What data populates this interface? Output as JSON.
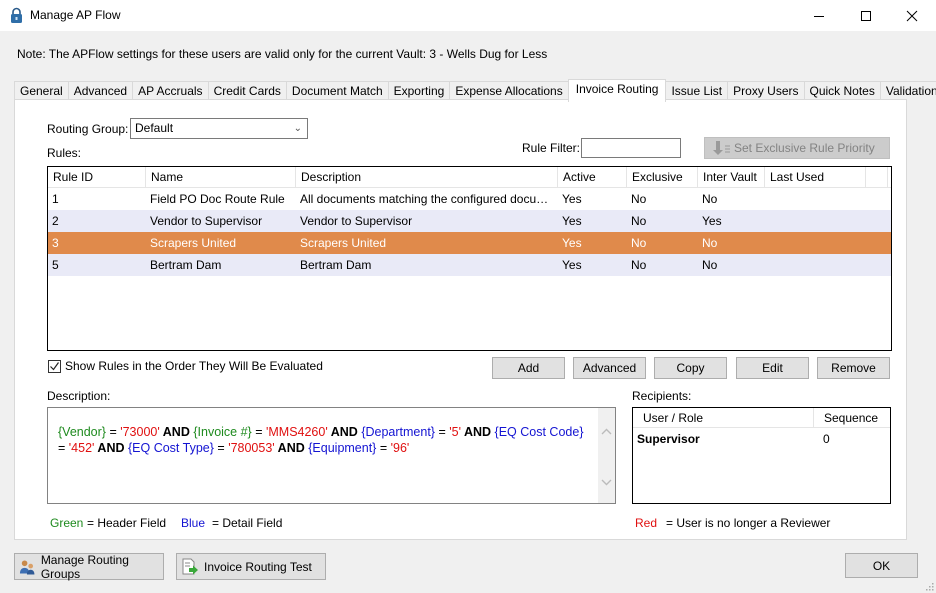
{
  "window": {
    "title": "Manage AP Flow",
    "icon": "padlock-icon",
    "controls": [
      "minimize",
      "maximize",
      "close"
    ]
  },
  "note": "Note:  The APFlow settings for these users are valid only for the current Vault: 3 - Wells Dug for Less",
  "tabs": [
    {
      "label": "General",
      "active": false
    },
    {
      "label": "Advanced",
      "active": false
    },
    {
      "label": "AP Accruals",
      "active": false
    },
    {
      "label": "Credit Cards",
      "active": false
    },
    {
      "label": "Document Match",
      "active": false
    },
    {
      "label": "Exporting",
      "active": false
    },
    {
      "label": "Expense Allocations",
      "active": false
    },
    {
      "label": "Invoice Routing",
      "active": true
    },
    {
      "label": "Issue List",
      "active": false
    },
    {
      "label": "Proxy Users",
      "active": false
    },
    {
      "label": "Quick Notes",
      "active": false
    },
    {
      "label": "Validation",
      "active": false
    }
  ],
  "routing_group": {
    "label": "Routing Group:",
    "value": "Default"
  },
  "rules_label": "Rules:",
  "rule_filter": {
    "label": "Rule Filter:",
    "value": "",
    "placeholder": ""
  },
  "set_priority_button": {
    "label": "Set Exclusive Rule Priority",
    "enabled": false,
    "icon": "sort-down-icon"
  },
  "rules_table": {
    "columns": [
      "Rule ID",
      "Name",
      "Description",
      "Active",
      "Exclusive",
      "Inter Vault",
      "Last Used"
    ],
    "rows": [
      {
        "id": "1",
        "name": "Field PO Doc Route Rule",
        "description": "All documents matching the configured document ty...",
        "active": "Yes",
        "exclusive": "No",
        "inter_vault": "No",
        "last_used": "",
        "selected": false
      },
      {
        "id": "2",
        "name": "Vendor to Supervisor",
        "description": "Vendor to Supervisor",
        "active": "Yes",
        "exclusive": "No",
        "inter_vault": "Yes",
        "last_used": "",
        "selected": false
      },
      {
        "id": "3",
        "name": "Scrapers United",
        "description": "Scrapers United",
        "active": "Yes",
        "exclusive": "No",
        "inter_vault": "No",
        "last_used": "",
        "selected": true
      },
      {
        "id": "5",
        "name": "Bertram Dam",
        "description": "Bertram Dam",
        "active": "Yes",
        "exclusive": "No",
        "inter_vault": "No",
        "last_used": "",
        "selected": false
      }
    ],
    "selected_color": "#e08a4b",
    "alt_row_color": "#e9eaf7"
  },
  "show_order_checkbox": {
    "label": "Show Rules in the Order They Will Be Evaluated",
    "checked": true
  },
  "rule_buttons": [
    {
      "label": "Add",
      "mnemonic": "A"
    },
    {
      "label": "Advanced",
      "mnemonic": "v"
    },
    {
      "label": "Copy",
      "mnemonic": "C"
    },
    {
      "label": "Edit",
      "mnemonic": "E"
    },
    {
      "label": "Remove",
      "mnemonic": "R"
    }
  ],
  "description": {
    "label": "Description:",
    "tokens": [
      {
        "t": "{Vendor}",
        "c": "g"
      },
      {
        "t": " = ",
        "c": ""
      },
      {
        "t": "'73000'",
        "c": "r"
      },
      {
        "t": " AND ",
        "c": "k"
      },
      {
        "t": "{Invoice #}",
        "c": "g"
      },
      {
        "t": " = ",
        "c": ""
      },
      {
        "t": "'MMS4260'",
        "c": "r"
      },
      {
        "t": " AND ",
        "c": "k"
      },
      {
        "t": "{Department}",
        "c": "b"
      },
      {
        "t": " = ",
        "c": ""
      },
      {
        "t": "'5'",
        "c": "r"
      },
      {
        "t": " AND ",
        "c": "k"
      },
      {
        "t": "{EQ Cost Code}",
        "c": "b"
      },
      {
        "t": " = ",
        "c": ""
      },
      {
        "t": "'452'",
        "c": "r"
      },
      {
        "t": " AND ",
        "c": "k"
      },
      {
        "t": "{EQ Cost Type}",
        "c": "b"
      },
      {
        "t": " = ",
        "c": ""
      },
      {
        "t": "'780053'",
        "c": "r"
      },
      {
        "t": " AND ",
        "c": "k"
      },
      {
        "t": "{Equipment}",
        "c": "b"
      },
      {
        "t": " = ",
        "c": ""
      },
      {
        "t": "'96'",
        "c": "r"
      }
    ]
  },
  "recipients": {
    "label": "Recipients:",
    "columns": [
      "User / Role",
      "Sequence"
    ],
    "rows": [
      {
        "user": "Supervisor",
        "sequence": "0"
      }
    ]
  },
  "legend": {
    "green": {
      "word": "Green",
      "meaning": "=  Header Field",
      "color": "#1e8a1e"
    },
    "blue": {
      "word": "Blue",
      "meaning": "=  Detail Field",
      "color": "#1414d2"
    },
    "red": {
      "word": "Red",
      "meaning": "=  User is no longer a Reviewer",
      "color": "#e01010"
    }
  },
  "footer": {
    "manage_groups": {
      "label": "Manage Routing Groups",
      "icon": "users-icon"
    },
    "routing_test": {
      "label": "Invoice Routing Test",
      "icon": "invoice-test-icon"
    },
    "ok": {
      "label": "OK"
    }
  }
}
